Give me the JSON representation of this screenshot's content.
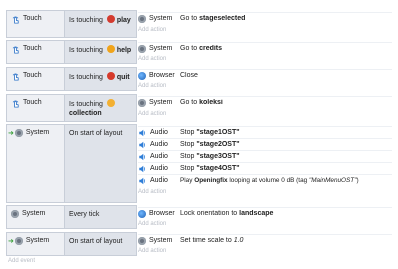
{
  "events": [
    {
      "condition": {
        "object": "Touch",
        "text": "Is touching",
        "target": "play",
        "badge": "#d33b2f",
        "badge_glyph": "▶"
      },
      "actions": [
        {
          "object": "System",
          "icon": "gear-icon",
          "text": "Go to ",
          "bold": "stageselected"
        }
      ],
      "add_action": "Add action"
    },
    {
      "condition": {
        "object": "Touch",
        "text": "Is touching",
        "target": "help",
        "badge": "#f0a41b",
        "badge_glyph": "?"
      },
      "actions": [
        {
          "object": "System",
          "icon": "gear-icon",
          "text": "Go to ",
          "bold": "credits"
        }
      ],
      "add_action": "Add action"
    },
    {
      "condition": {
        "object": "Touch",
        "text": "Is touching",
        "target": "quit",
        "badge": "#d63a2b",
        "badge_glyph": "✕"
      },
      "actions": [
        {
          "object": "Browser",
          "icon": "browser-icon",
          "text": "Close",
          "bold": ""
        }
      ],
      "add_action": "Add action"
    },
    {
      "condition": {
        "object": "Touch",
        "text": "Is touching",
        "target": "collection",
        "badge": "#f3b032",
        "badge_glyph": "•"
      },
      "actions": [
        {
          "object": "System",
          "icon": "gear-icon",
          "text": "Go to ",
          "bold": "koleksi"
        }
      ],
      "add_action": "Add action"
    },
    {
      "condition": {
        "object": "System",
        "text": "On start of layout"
      },
      "actions": [
        {
          "object": "Audio",
          "icon": "audio-icon",
          "text": "Stop ",
          "bold": "\"stage1OST\""
        },
        {
          "object": "Audio",
          "icon": "audio-icon",
          "text": "Stop ",
          "bold": "\"stage2OST\""
        },
        {
          "object": "Audio",
          "icon": "audio-icon",
          "text": "Stop ",
          "bold": "\"stage3OST\""
        },
        {
          "object": "Audio",
          "icon": "audio-icon",
          "text": "Stop ",
          "bold": "\"stage4OST\""
        },
        {
          "object": "Audio",
          "icon": "audio-icon",
          "text": "Play ",
          "bold": "Openingfix",
          "tail": " looping at volume 0 dB (tag ",
          "tag": "\"MainMenuOST\"",
          "close": ")"
        }
      ],
      "add_action": "Add action"
    },
    {
      "condition": {
        "object": "System",
        "text": "Every tick"
      },
      "actions": [
        {
          "object": "Browser",
          "icon": "browser-icon",
          "text": "Lock orientation to ",
          "bold": "landscape"
        }
      ],
      "add_action": "Add action"
    },
    {
      "condition": {
        "object": "System",
        "text": "On start of layout"
      },
      "actions": [
        {
          "object": "System",
          "icon": "gear-icon",
          "text": "Set time scale to ",
          "italic": "1.0"
        }
      ],
      "add_action": "Add action"
    }
  ],
  "add_event": "Add event",
  "colors": {
    "accent_green": "#3aa03a",
    "panel_bg": "#dfe3ea"
  }
}
